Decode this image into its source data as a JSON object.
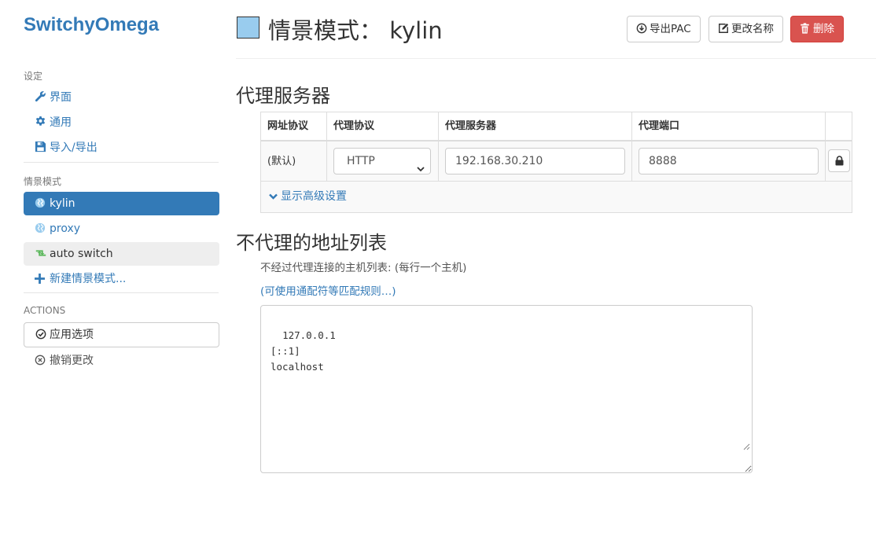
{
  "brand": "SwitchyOmega",
  "sidebar": {
    "settings_header": "设定",
    "settings_items": [
      {
        "label": "界面",
        "icon": "wrench-icon"
      },
      {
        "label": "通用",
        "icon": "gear-icon"
      },
      {
        "label": "导入/导出",
        "icon": "floppy-icon"
      }
    ],
    "profiles_header": "情景模式",
    "profiles": [
      {
        "label": "kylin",
        "icon": "globe-icon",
        "active": true
      },
      {
        "label": "proxy",
        "icon": "globe-icon"
      },
      {
        "label": "auto switch",
        "icon": "retweet-icon"
      }
    ],
    "new_profile": "新建情景模式...",
    "actions_header": "ACTIONS",
    "apply": "应用选项",
    "discard": "撤销更改"
  },
  "header": {
    "title": "情景模式：  kylin",
    "profile_color": "#99ccee",
    "export_pac": "导出PAC",
    "rename": "更改名称",
    "delete": "删除"
  },
  "proxy_servers": {
    "heading": "代理服务器",
    "columns": [
      "网址协议",
      "代理协议",
      "代理服务器",
      "代理端口"
    ],
    "row": {
      "scheme": "(默认)",
      "protocol": "HTTP",
      "server": "192.168.30.210",
      "port": "8888"
    },
    "advanced": "显示高级设置"
  },
  "bypass": {
    "heading": "不代理的地址列表",
    "help": "不经过代理连接的主机列表: (每行一个主机)",
    "rules_link": "(可使用通配符等匹配规则…)",
    "list": "127.0.0.1\n[::1]\nlocalhost"
  },
  "colors": {
    "primary": "#337ab7",
    "danger": "#d9534f",
    "active_bg": "#337ab7"
  }
}
